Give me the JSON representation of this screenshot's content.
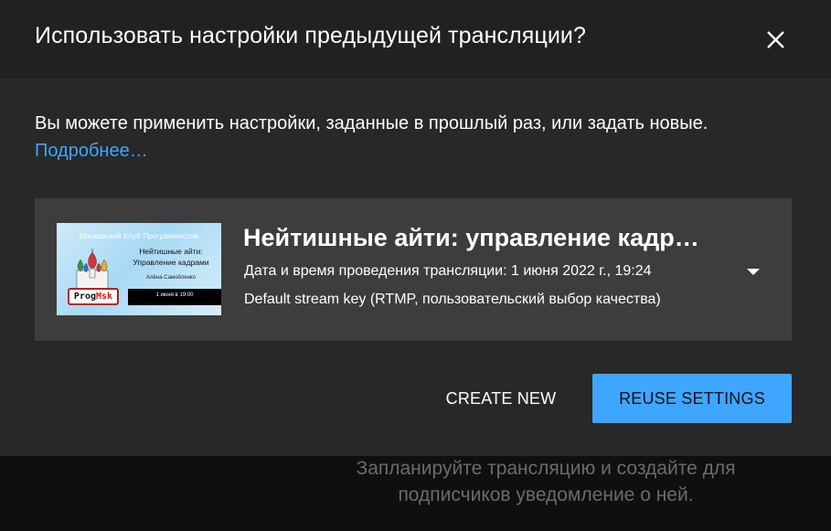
{
  "background": {
    "text": "Запланируйте трансляцию и создайте для подписчиков уведомление о ней."
  },
  "dialog": {
    "title": "Использовать настройки предыдущей трансляции?",
    "close_icon": "close-icon",
    "body_text": "Вы можете применить настройки, заданные в прошлый раз, или задать новые.",
    "learn_more": "Подробнее…",
    "card": {
      "title": "Нейтишные айти: управление кадрами",
      "date_line": "Дата и время проведения трансляции: 1 июня 2022 г., 19:24",
      "key_line": "Default stream key (RTMP, пользовательский выбор качества)",
      "dropdown_icon": "chevron-down-icon",
      "thumbnail": {
        "club": "Московский Клуб Программистов",
        "title_line1": "Нейтишные айти:",
        "title_line2": "Управление кадрами",
        "author": "Алёна Самойленко",
        "date": "1 июня в 19:00",
        "logo_prog": "Prog",
        "logo_msk": "Msk"
      }
    },
    "buttons": {
      "create_new": "CREATE NEW",
      "reuse": "REUSE SETTINGS"
    }
  },
  "colors": {
    "accent": "#3ea6ff",
    "dialog_bg": "#282828",
    "header_bg": "#212121",
    "card_bg": "#3d3d3d"
  }
}
